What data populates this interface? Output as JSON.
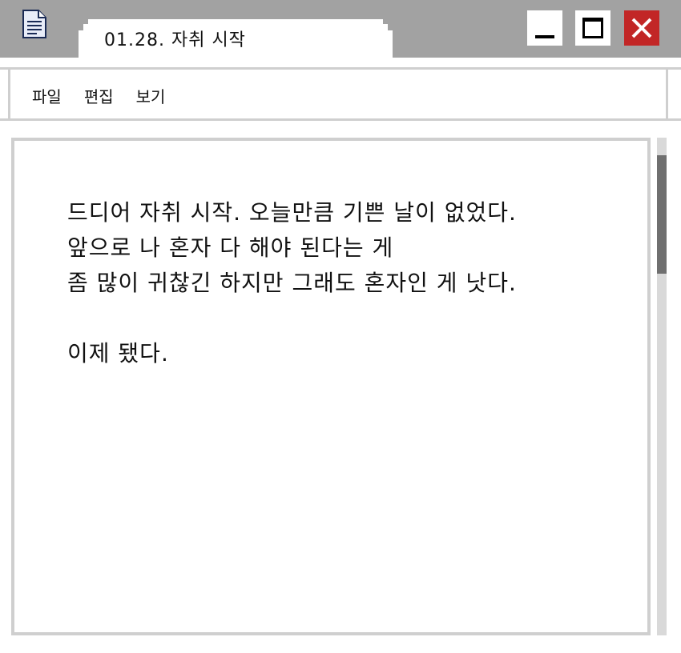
{
  "window": {
    "tab_title": "01.28. 자취 시작",
    "app_icon": "notepad-document-icon",
    "controls": {
      "minimize": "minimize-icon",
      "maximize": "maximize-icon",
      "close": "close-icon"
    },
    "colors": {
      "titlebar": "#a2a2a2",
      "close_button": "#c22626",
      "border": "#cfcfcf",
      "scroll_thumb": "#6f6f6f"
    }
  },
  "menu": {
    "items": [
      {
        "label": "파일"
      },
      {
        "label": "편집"
      },
      {
        "label": "보기"
      }
    ]
  },
  "document": {
    "lines": [
      "드디어 자취 시작. 오늘만큼 기쁜 날이 없었다.",
      "앞으로 나 혼자 다 해야 된다는 게",
      "좀 많이 귀찮긴 하지만 그래도 혼자인 게 낫다.",
      "",
      "이제 됐다."
    ]
  }
}
